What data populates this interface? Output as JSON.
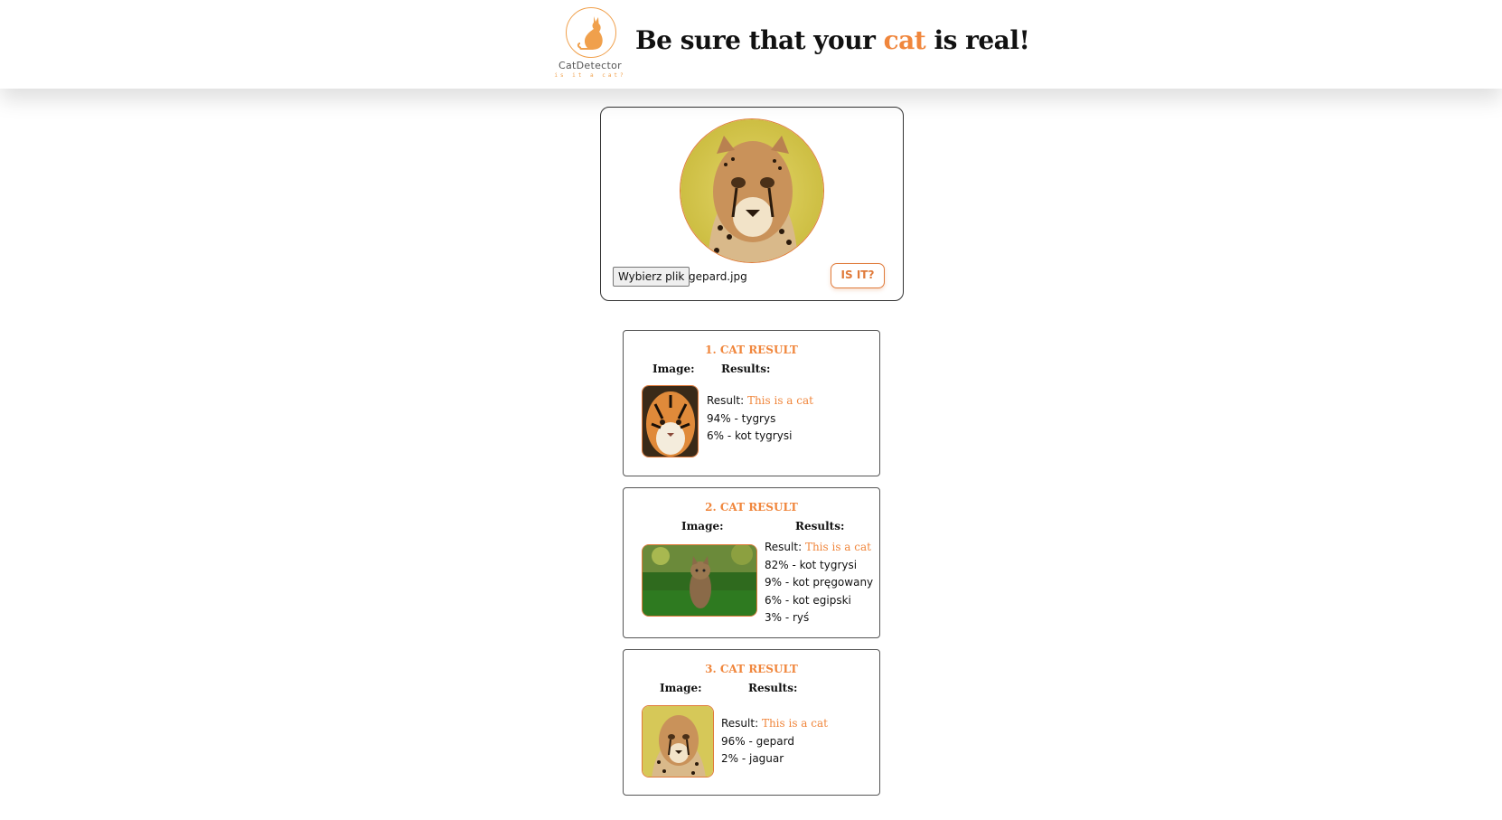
{
  "header": {
    "logo_name": "CatDetector",
    "logo_tagline": "is it a cat?",
    "title_before": "Be sure that your ",
    "title_accent": "cat",
    "title_after": " is real!"
  },
  "upload": {
    "file_button_label": "Wybierz plik",
    "file_name": "gepard.jpg",
    "submit_label": "IS IT?"
  },
  "labels": {
    "image": "Image:",
    "results": "Results:",
    "result_prefix": "Result: "
  },
  "results": [
    {
      "title": "1. CAT RESULT",
      "verdict": "This is a cat",
      "predictions": [
        "94% - tygrys",
        "6% - kot tygrysi"
      ]
    },
    {
      "title": "2. CAT RESULT",
      "verdict": "This is a cat",
      "predictions": [
        "82% - kot tygrysi",
        "9% - kot pręgowany",
        "6% - kot egipski",
        "3% - ryś"
      ]
    },
    {
      "title": "3. CAT RESULT",
      "verdict": "This is a cat",
      "predictions": [
        "96% - gepard",
        "2% - jaguar"
      ]
    }
  ],
  "colors": {
    "accent": "#f0863c",
    "border_accent": "#e07a3a"
  }
}
